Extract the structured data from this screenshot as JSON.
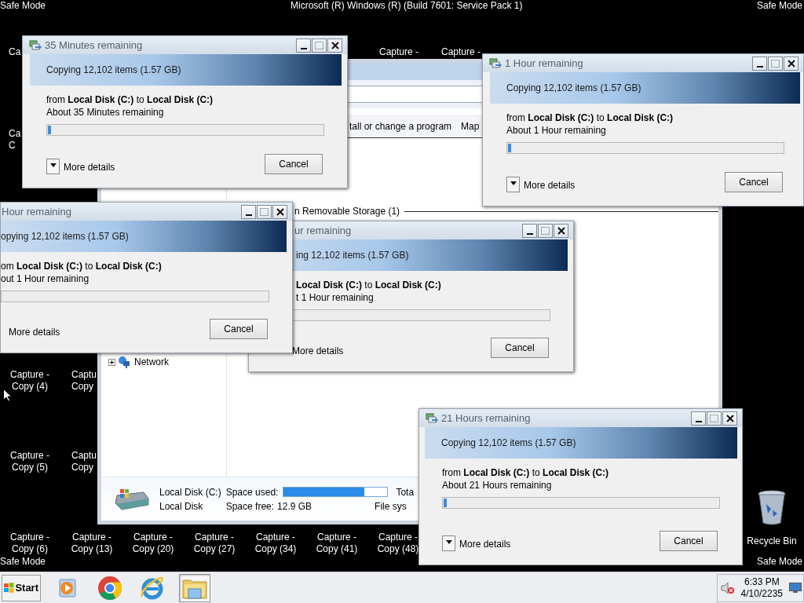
{
  "desktop": {
    "top_left": "Safe Mode",
    "top_center": "Microsoft (R) Windows (R) (Build 7601: Service Pack 1)",
    "top_right": "Safe Mode",
    "bottom_left": "Safe Mode",
    "bottom_right": "Safe Mode"
  },
  "desktop_icons": [
    {
      "lines": [
        "Ca"
      ]
    },
    {
      "lines": [
        "Capture -"
      ]
    },
    {
      "lines": [
        "Capture -"
      ]
    },
    {
      "lines": [
        "Ca",
        "C"
      ]
    },
    {
      "lines": [
        "Capture -",
        "Copy (4)"
      ]
    },
    {
      "lines": [
        "Captu",
        "Copy"
      ]
    },
    {
      "lines": [
        "Capture -",
        "Copy (5)"
      ]
    },
    {
      "lines": [
        "Captu",
        "Copy"
      ]
    },
    {
      "lines": [
        "Capture -",
        "Copy (6)"
      ]
    },
    {
      "lines": [
        "Capture -",
        "Copy (13)"
      ]
    },
    {
      "lines": [
        "Capture -",
        "Copy (20)"
      ]
    },
    {
      "lines": [
        "Capture -",
        "Copy (27)"
      ]
    },
    {
      "lines": [
        "Capture -",
        "Copy (34)"
      ]
    },
    {
      "lines": [
        "Capture -",
        "Copy (41)"
      ]
    },
    {
      "lines": [
        "Capture -",
        "Copy (48)"
      ]
    }
  ],
  "recycle_bin": {
    "label": "Recycle Bin"
  },
  "explorer": {
    "toolbar": [
      "tall or change a program",
      "Map"
    ],
    "group_header": "n Removable Storage (1)",
    "nav": [
      {
        "label": "Network",
        "expanded": false
      }
    ],
    "details": {
      "name": "Local Disk (C:)",
      "type": "Local Disk",
      "space_used_label": "Space used:",
      "level": 0.78,
      "space_free_label": "Space free:",
      "space_free": "12.9 GB",
      "total_label": "Tota",
      "filesystem_label": "File sys"
    }
  },
  "dialogs": [
    {
      "title": "35 Minutes remaining",
      "header": "Copying 12,102 items (1.57 GB)",
      "route": "from **Local Disk (C:)** to **Local Disk (C:)**",
      "eta": "About 35 Minutes remaining",
      "level": 0.012,
      "more_details": "More details",
      "cancel": "Cancel"
    },
    {
      "title": "1 Hour remaining",
      "header": "Copying 12,102 items (1.57 GB)",
      "route": "from **Local Disk (C:)** to **Local Disk (C:)**",
      "eta": "About 1 Hour remaining",
      "level": 0.012,
      "more_details": "More details",
      "cancel": "Cancel"
    },
    {
      "title": "Hour remaining",
      "header": "opying 12,102 items (1.57 GB)",
      "route": "om **Local Disk (C:)** to **Local Disk (C:)**",
      "eta": "out 1 Hour remaining",
      "more_details": "More details",
      "cancel": "Cancel"
    },
    {
      "title": "ur remaining",
      "header": "ing 12,102 items (1.57 GB)",
      "route": "**Local Disk (C:)** to **Local Disk (C:)**",
      "eta": "t 1 Hour remaining",
      "more_details": "More details",
      "cancel": "Cancel"
    },
    {
      "title": "21 Hours remaining",
      "header": "Copying 12,102 items (1.57 GB)",
      "route": "from **Local Disk (C:)** to **Local Disk (C:)**",
      "eta": "About 21 Hours remaining",
      "level": 0.012,
      "more_details": "More details",
      "cancel": "Cancel"
    }
  ],
  "taskbar": {
    "start": "Start",
    "apps": [
      {
        "kind": "media",
        "selected": false
      },
      {
        "kind": "chrome",
        "selected": false
      },
      {
        "kind": "ie",
        "selected": false
      },
      {
        "kind": "folder",
        "selected": true
      }
    ],
    "tray": {
      "volume_muted": true,
      "time": "6:33 PM",
      "date": "4/10/2235"
    }
  }
}
